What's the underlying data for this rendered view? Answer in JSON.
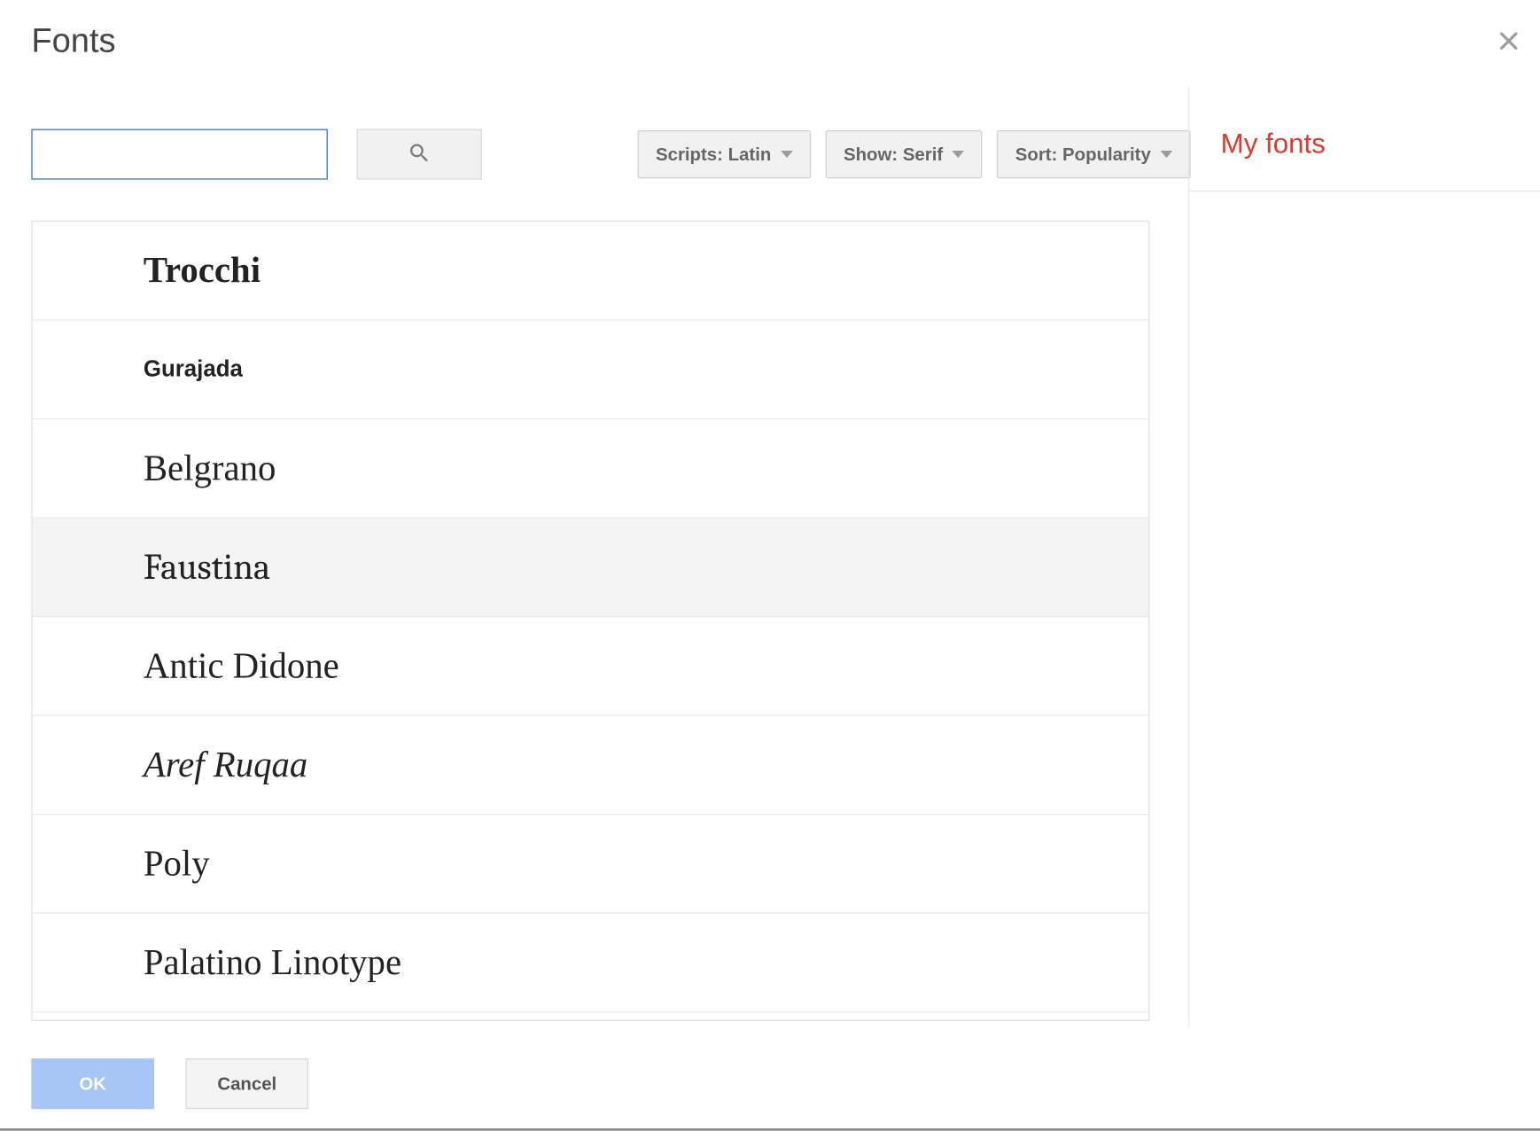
{
  "dialog": {
    "title": "Fonts"
  },
  "controls": {
    "search_value": "",
    "search_placeholder": "",
    "scripts_dropdown": "Scripts: Latin",
    "show_dropdown": "Show: Serif",
    "sort_dropdown": "Sort: Popularity"
  },
  "fonts": [
    {
      "name": "Trocchi"
    },
    {
      "name": "Gurajada"
    },
    {
      "name": "Belgrano"
    },
    {
      "name": "Faustina"
    },
    {
      "name": "Antic Didone"
    },
    {
      "name": "Aref Ruqaa"
    },
    {
      "name": "Poly"
    },
    {
      "name": "Palatino Linotype"
    }
  ],
  "highlighted_index": 3,
  "sidebar": {
    "title": "My fonts"
  },
  "footer": {
    "ok_label": "OK",
    "cancel_label": "Cancel"
  }
}
